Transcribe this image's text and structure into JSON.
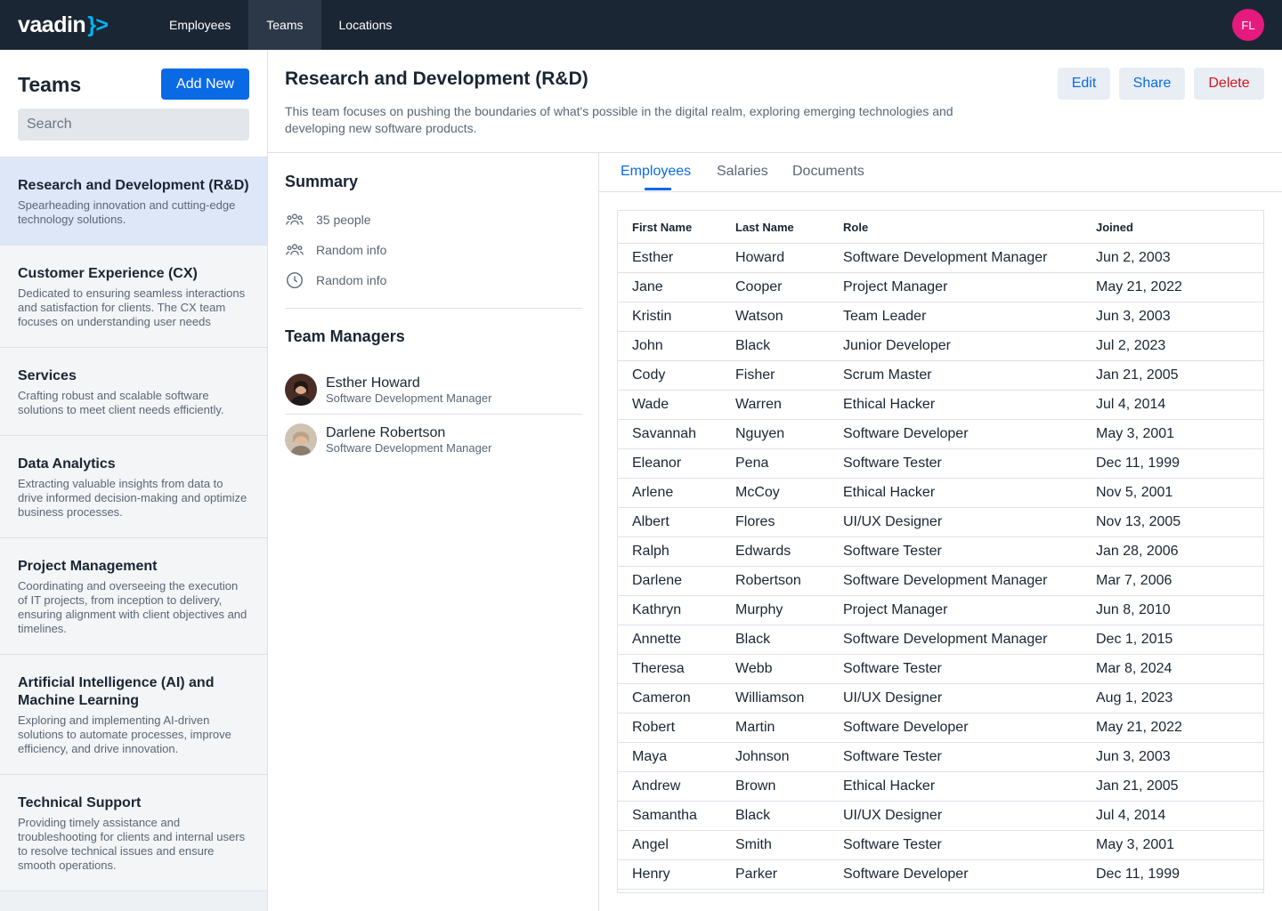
{
  "brand": {
    "logo_text": "vaadin",
    "logo_mark": "}>"
  },
  "nav": {
    "tabs": [
      {
        "label": "Employees",
        "active": false
      },
      {
        "label": "Teams",
        "active": true
      },
      {
        "label": "Locations",
        "active": false
      }
    ],
    "user_initials": "FL",
    "avatar_color": "#e6197e"
  },
  "sidebar": {
    "title": "Teams",
    "add_label": "Add New",
    "search_placeholder": "Search",
    "teams": [
      {
        "name": "Research and Development (R&D)",
        "desc": "Spearheading innovation and cutting-edge technology solutions.",
        "selected": true
      },
      {
        "name": "Customer Experience (CX)",
        "desc": "Dedicated to ensuring seamless interactions and satisfaction for clients. The CX team focuses on understanding user needs"
      },
      {
        "name": "Services",
        "desc": "Crafting robust and scalable software solutions to meet client needs efficiently."
      },
      {
        "name": "Data Analytics",
        "desc": "Extracting valuable insights from data to drive informed decision-making and optimize business processes."
      },
      {
        "name": "Project Management",
        "desc": "Coordinating and overseeing the execution of IT projects, from inception to delivery, ensuring alignment with client objectives and timelines."
      },
      {
        "name": "Artificial Intelligence (AI) and Machine Learning",
        "desc": "Exploring and implementing AI-driven solutions to automate processes, improve efficiency, and drive innovation."
      },
      {
        "name": "Technical Support",
        "desc": "Providing timely assistance and troubleshooting for clients and internal users to resolve technical issues and ensure smooth operations."
      }
    ]
  },
  "header": {
    "title": "Research and Development (R&D)",
    "description": "This team focuses on pushing the boundaries of what's possible in the digital realm, exploring emerging technologies and developing new software products.",
    "edit_label": "Edit",
    "share_label": "Share",
    "delete_label": "Delete"
  },
  "summary": {
    "title": "Summary",
    "rows": [
      {
        "icon": "group-icon",
        "text": "35 people"
      },
      {
        "icon": "group-icon",
        "text": "Random info"
      },
      {
        "icon": "clock-icon",
        "text": "Random info"
      }
    ],
    "managers_title": "Team Managers",
    "managers": [
      {
        "name": "Esther Howard",
        "role": "Software Development Manager"
      },
      {
        "name": "Darlene Robertson",
        "role": "Software Development Manager"
      }
    ]
  },
  "tabs": [
    {
      "label": "Employees",
      "active": true
    },
    {
      "label": "Salaries",
      "active": false
    },
    {
      "label": "Documents",
      "active": false
    }
  ],
  "table": {
    "columns": [
      "First Name",
      "Last Name",
      "Role",
      "Joined"
    ],
    "rows": [
      [
        "Esther",
        "Howard",
        "Software Development Manager",
        "Jun 2, 2003"
      ],
      [
        "Jane",
        "Cooper",
        "Project Manager",
        "May 21, 2022"
      ],
      [
        "Kristin",
        "Watson",
        "Team Leader",
        "Jun 3, 2003"
      ],
      [
        "John",
        "Black",
        "Junior Developer",
        "Jul 2, 2023"
      ],
      [
        "Cody",
        "Fisher",
        "Scrum Master",
        "Jan 21, 2005"
      ],
      [
        "Wade",
        "Warren",
        "Ethical Hacker",
        "Jul 4, 2014"
      ],
      [
        "Savannah",
        "Nguyen",
        "Software Developer",
        "May 3, 2001"
      ],
      [
        "Eleanor",
        "Pena",
        "Software Tester",
        "Dec 11, 1999"
      ],
      [
        "Arlene",
        "McCoy",
        "Ethical Hacker",
        "Nov 5, 2001"
      ],
      [
        "Albert",
        "Flores",
        "UI/UX Designer",
        "Nov 13, 2005"
      ],
      [
        "Ralph",
        "Edwards",
        "Software Tester",
        "Jan 28, 2006"
      ],
      [
        "Darlene",
        "Robertson",
        "Software Development Manager",
        "Mar 7, 2006"
      ],
      [
        "Kathryn",
        "Murphy",
        "Project Manager",
        "Jun 8, 2010"
      ],
      [
        "Annette",
        "Black",
        "Software Development Manager",
        "Dec 1, 2015"
      ],
      [
        "Theresa",
        "Webb",
        "Software Tester",
        "Mar 8, 2024"
      ],
      [
        "Cameron",
        "Williamson",
        "UI/UX Designer",
        "Aug 1, 2023"
      ],
      [
        "Robert",
        "Martin",
        "Software Developer",
        "May 21, 2022"
      ],
      [
        "Maya",
        "Johnson",
        "Software Tester",
        "Jun 3, 2003"
      ],
      [
        "Andrew",
        "Brown",
        "Ethical Hacker",
        "Jan 21, 2005"
      ],
      [
        "Samantha",
        "Black",
        "UI/UX Designer",
        "Jul 4, 2014"
      ],
      [
        "Angel",
        "Smith",
        "Software Tester",
        "May 3, 2001"
      ],
      [
        "Henry",
        "Parker",
        "Software Developer",
        "Dec 11, 1999"
      ]
    ]
  },
  "colors": {
    "primary": "#0a6ae6",
    "danger": "#d6141e",
    "nav_bg": "#1b2635",
    "selected_bg": "#dde7f7"
  }
}
